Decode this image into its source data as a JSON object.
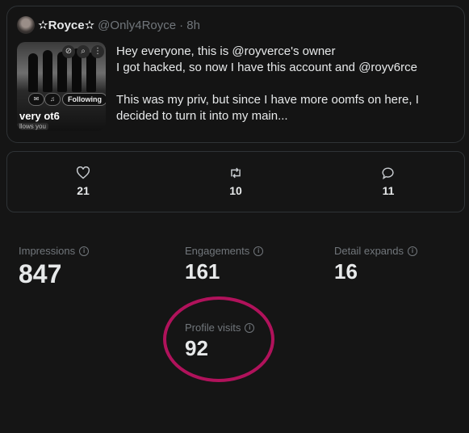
{
  "tweet": {
    "display_name": "✫Royce✫",
    "handle": "@Only4Royce",
    "time": "· 8h",
    "line1": "Hey everyone, this is @royverce's owner",
    "line2": "I got hacked, so now I have this account and @royv6rce",
    "line3": "This was my priv, but since I have more oomfs on here, I",
    "line4": "decided to turn it into my main..."
  },
  "attached_profile": {
    "name": "very ot6",
    "following_label": "Following",
    "follows_you": "llows you"
  },
  "actions": {
    "likes": "21",
    "retweets": "10",
    "replies": "11"
  },
  "metrics": {
    "impressions_label": "Impressions",
    "impressions_value": "847",
    "engagements_label": "Engagements",
    "engagements_value": "161",
    "detail_expands_label": "Detail expands",
    "detail_expands_value": "16",
    "profile_visits_label": "Profile visits",
    "profile_visits_value": "92"
  },
  "colors": {
    "background": "#151515",
    "annotation_circle": "#b0125b",
    "muted_text": "#71767b"
  }
}
